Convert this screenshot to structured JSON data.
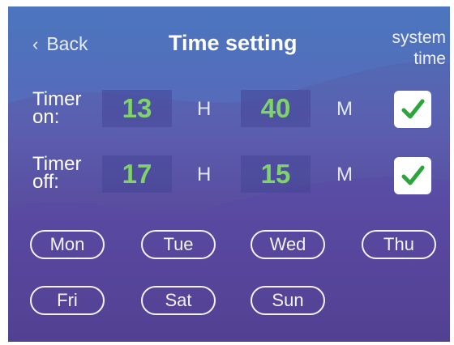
{
  "header": {
    "back_label": "Back",
    "title": "Time setting",
    "system_time_line1": "system",
    "system_time_line2": "time"
  },
  "timer_on": {
    "label_line1": "Timer",
    "label_line2": "on:",
    "hours": "13",
    "hour_unit": "H",
    "minutes": "40",
    "minute_unit": "M",
    "checked": true
  },
  "timer_off": {
    "label_line1": "Timer",
    "label_line2": "off:",
    "hours": "17",
    "hour_unit": "H",
    "minutes": "15",
    "minute_unit": "M",
    "checked": true
  },
  "days": [
    "Mon",
    "Tue",
    "Wed",
    "Thu",
    "Fri",
    "Sat",
    "Sun"
  ],
  "colors": {
    "value_green": "#7fd36a",
    "check_green": "#2aa63a",
    "background_top": "#4b72b8",
    "background_bottom": "#4f3f86"
  }
}
